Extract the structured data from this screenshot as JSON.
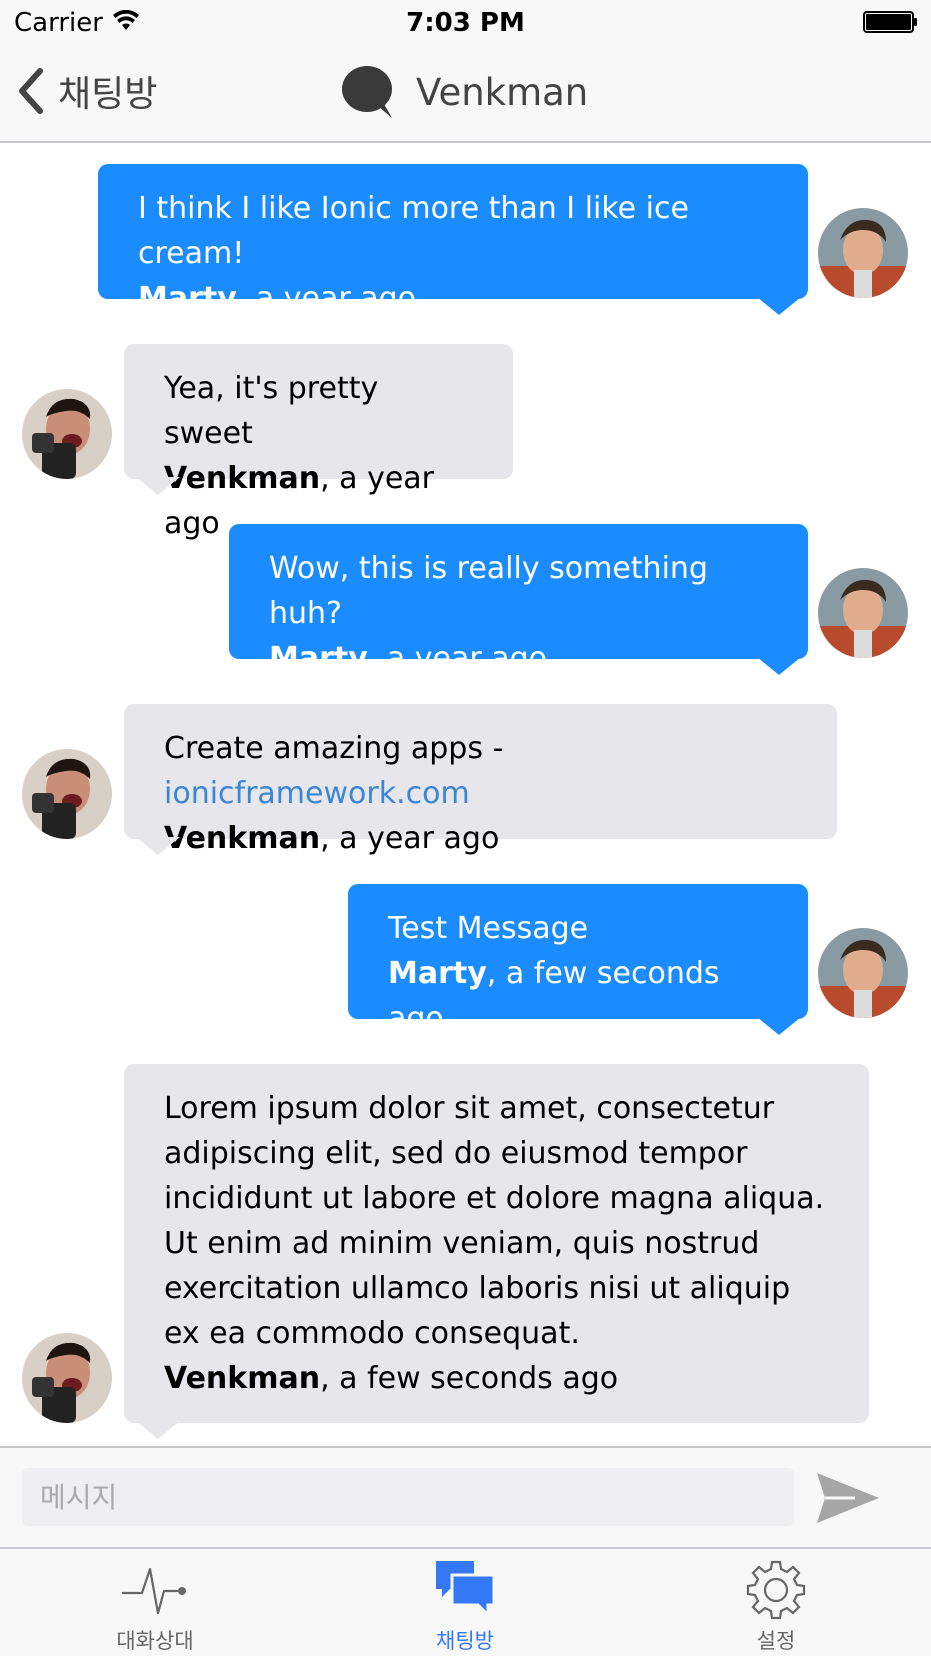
{
  "status_bar": {
    "carrier": "Carrier",
    "time": "7:03 PM"
  },
  "nav": {
    "back_label": "채팅방",
    "title": "Venkman"
  },
  "messages": [
    {
      "side": "out",
      "text": "I think I like Ionic more than I like ice cream!",
      "author": "Marty",
      "time": ", a year ago"
    },
    {
      "side": "in",
      "text": "Yea, it's pretty sweet",
      "author": "Venkman",
      "time": ", a year ago"
    },
    {
      "side": "out",
      "text": "Wow, this is really something huh?",
      "author": "Marty",
      "time": ", a year ago"
    },
    {
      "side": "in",
      "text_prefix": "Create amazing apps - ",
      "link": "ionicframework.com",
      "author": "Venkman",
      "time": ", a year ago"
    },
    {
      "side": "out",
      "text": "Test Message",
      "author": "Marty",
      "time": ", a few seconds ago"
    },
    {
      "side": "in",
      "text": "Lorem ipsum dolor sit amet, consectetur adipiscing elit, sed do eiusmod tempor incididunt ut labore et dolore magna aliqua. Ut enim ad minim veniam, quis nostrud exercitation ullamco laboris nisi ut aliquip ex ea commodo consequat.",
      "author": "Venkman",
      "time": ", a few seconds ago"
    }
  ],
  "input": {
    "placeholder": "메시지",
    "value": ""
  },
  "tabs": [
    {
      "label": "대화상대",
      "icon": "pulse-icon",
      "active": false
    },
    {
      "label": "채팅방",
      "icon": "chats-icon",
      "active": true
    },
    {
      "label": "설정",
      "icon": "gear-icon",
      "active": false
    }
  ],
  "colors": {
    "accent": "#1a8cff",
    "incoming_bubble": "#e6e6eb",
    "link": "#3a87d6",
    "tab_active": "#3478f6"
  }
}
